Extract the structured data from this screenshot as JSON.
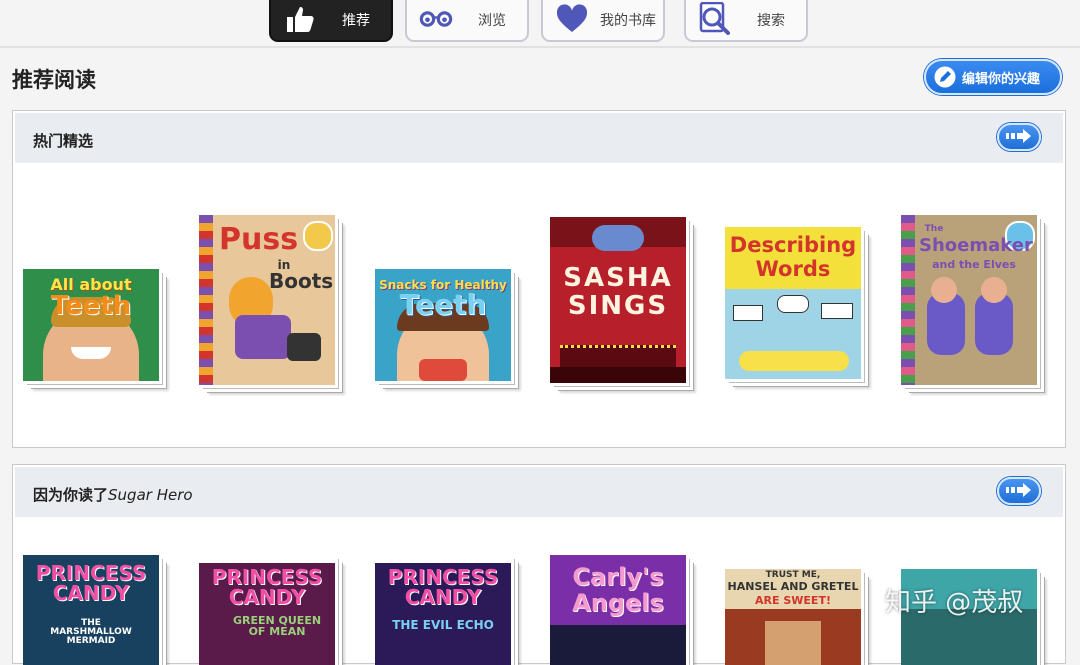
{
  "nav": {
    "items": [
      {
        "label": "推荐",
        "icon": "thumbs-up-icon",
        "active": true
      },
      {
        "label": "浏览",
        "icon": "glasses-icon",
        "active": false
      },
      {
        "label": "我的书库",
        "icon": "heart-icon",
        "active": false
      },
      {
        "label": "搜索",
        "icon": "search-icon",
        "active": false
      }
    ]
  },
  "page": {
    "title": "推荐阅读",
    "edit_button": "编辑你的兴趣"
  },
  "sections": [
    {
      "title": "热门精选",
      "books": [
        {
          "title_lines": [
            "All about",
            "Teeth"
          ],
          "bg": "#2f8f4a",
          "title_color": "#f28c1a"
        },
        {
          "title_lines": [
            "Puss",
            "in",
            "Boots"
          ],
          "bg": "#e8c79a",
          "title_color": "#d3342b"
        },
        {
          "title_lines": [
            "Snacks for Healthy",
            "Teeth"
          ],
          "bg": "#3aa4c8",
          "title_color": "#f7e04a"
        },
        {
          "title_lines": [
            "SASHA",
            "SINGS"
          ],
          "bg": "#b7202a",
          "title_color": "#fff4e0"
        },
        {
          "title_lines": [
            "Describing",
            "Words"
          ],
          "bg": "#f4e03a",
          "title_color": "#d3342b"
        },
        {
          "title_lines": [
            "The",
            "Shoemaker",
            "and the Elves"
          ],
          "bg": "#b9a27a",
          "title_color": "#7a4fb0"
        }
      ]
    },
    {
      "title": "因为你读了",
      "title_italic": "Sugar Hero",
      "books": [
        {
          "title_lines": [
            "PRINCESS",
            "CANDY",
            "THE MARSHMALLOW MERMAID"
          ],
          "bg": "#17415f",
          "title_color": "#f04fa6"
        },
        {
          "title_lines": [
            "PRINCESS",
            "CANDY",
            "GREEN QUEEN OF MEAN"
          ],
          "bg": "#5a1a4a",
          "title_color": "#f04fa6"
        },
        {
          "title_lines": [
            "PRINCESS",
            "CANDY",
            "THE EVIL ECHO"
          ],
          "bg": "#2c1a58",
          "title_color": "#f04fa6"
        },
        {
          "title_lines": [
            "Carly's",
            "Angels"
          ],
          "bg": "#7a2fa8",
          "title_color": "#f59ad0"
        },
        {
          "title_lines": [
            "TRUST ME,",
            "HANSEL AND GRETEL",
            "ARE SWEET!"
          ],
          "bg": "#9a3a20",
          "title_color": "#ffffff"
        },
        {
          "title_lines": [
            "",
            "",
            ""
          ],
          "bg": "#3fa6a8",
          "title_color": "#ffffff"
        }
      ]
    }
  ],
  "watermark": "知乎 @茂叔"
}
